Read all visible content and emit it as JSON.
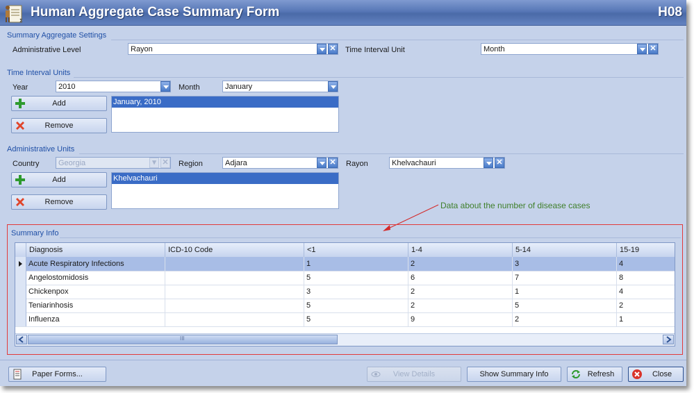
{
  "window": {
    "title": "Human Aggregate Case Summary Form",
    "code": "H08"
  },
  "settings": {
    "group_title": "Summary Aggregate Settings",
    "admin_level_label": "Administrative Level",
    "admin_level_value": "Rayon",
    "time_interval_label": "Time Interval Unit",
    "time_interval_value": "Month"
  },
  "time_units": {
    "group_title": "Time Interval Units",
    "year_label": "Year",
    "year_value": "2010",
    "month_label": "Month",
    "month_value": "January",
    "add_label": "Add",
    "remove_label": "Remove",
    "list": [
      "January, 2010"
    ]
  },
  "admin_units": {
    "group_title": "Administrative Units",
    "country_label": "Country",
    "country_value": "Georgia",
    "region_label": "Region",
    "region_value": "Adjara",
    "rayon_label": "Rayon",
    "rayon_value": "Khelvachauri",
    "add_label": "Add",
    "remove_label": "Remove",
    "list": [
      "Khelvachauri"
    ]
  },
  "annotation": "Data about the number of disease cases",
  "summary": {
    "group_title": "Summary Info",
    "columns": [
      "Diagnosis",
      "ICD-10 Code",
      "<1",
      "1-4",
      "5-14",
      "15-19"
    ],
    "rows": [
      [
        "Acute Respiratory Infections",
        "",
        "1",
        "2",
        "3",
        "4"
      ],
      [
        "Angelostomidosis",
        "",
        "5",
        "6",
        "7",
        "8"
      ],
      [
        "Chickenpox",
        "",
        "3",
        "2",
        "1",
        "4"
      ],
      [
        "Teniarinhosis",
        "",
        "5",
        "2",
        "5",
        "2"
      ],
      [
        "Influenza",
        "",
        "5",
        "9",
        "2",
        "1"
      ]
    ],
    "scroll_grip": "III"
  },
  "footer": {
    "paper_forms": "Paper Forms...",
    "view_details": "View Details",
    "show_summary": "Show Summary Info",
    "refresh": "Refresh",
    "close": "Close"
  },
  "colors": {
    "accent": "#3a6cc6",
    "highlight_box": "#e23a3a",
    "annotation": "#3f7f2a"
  }
}
